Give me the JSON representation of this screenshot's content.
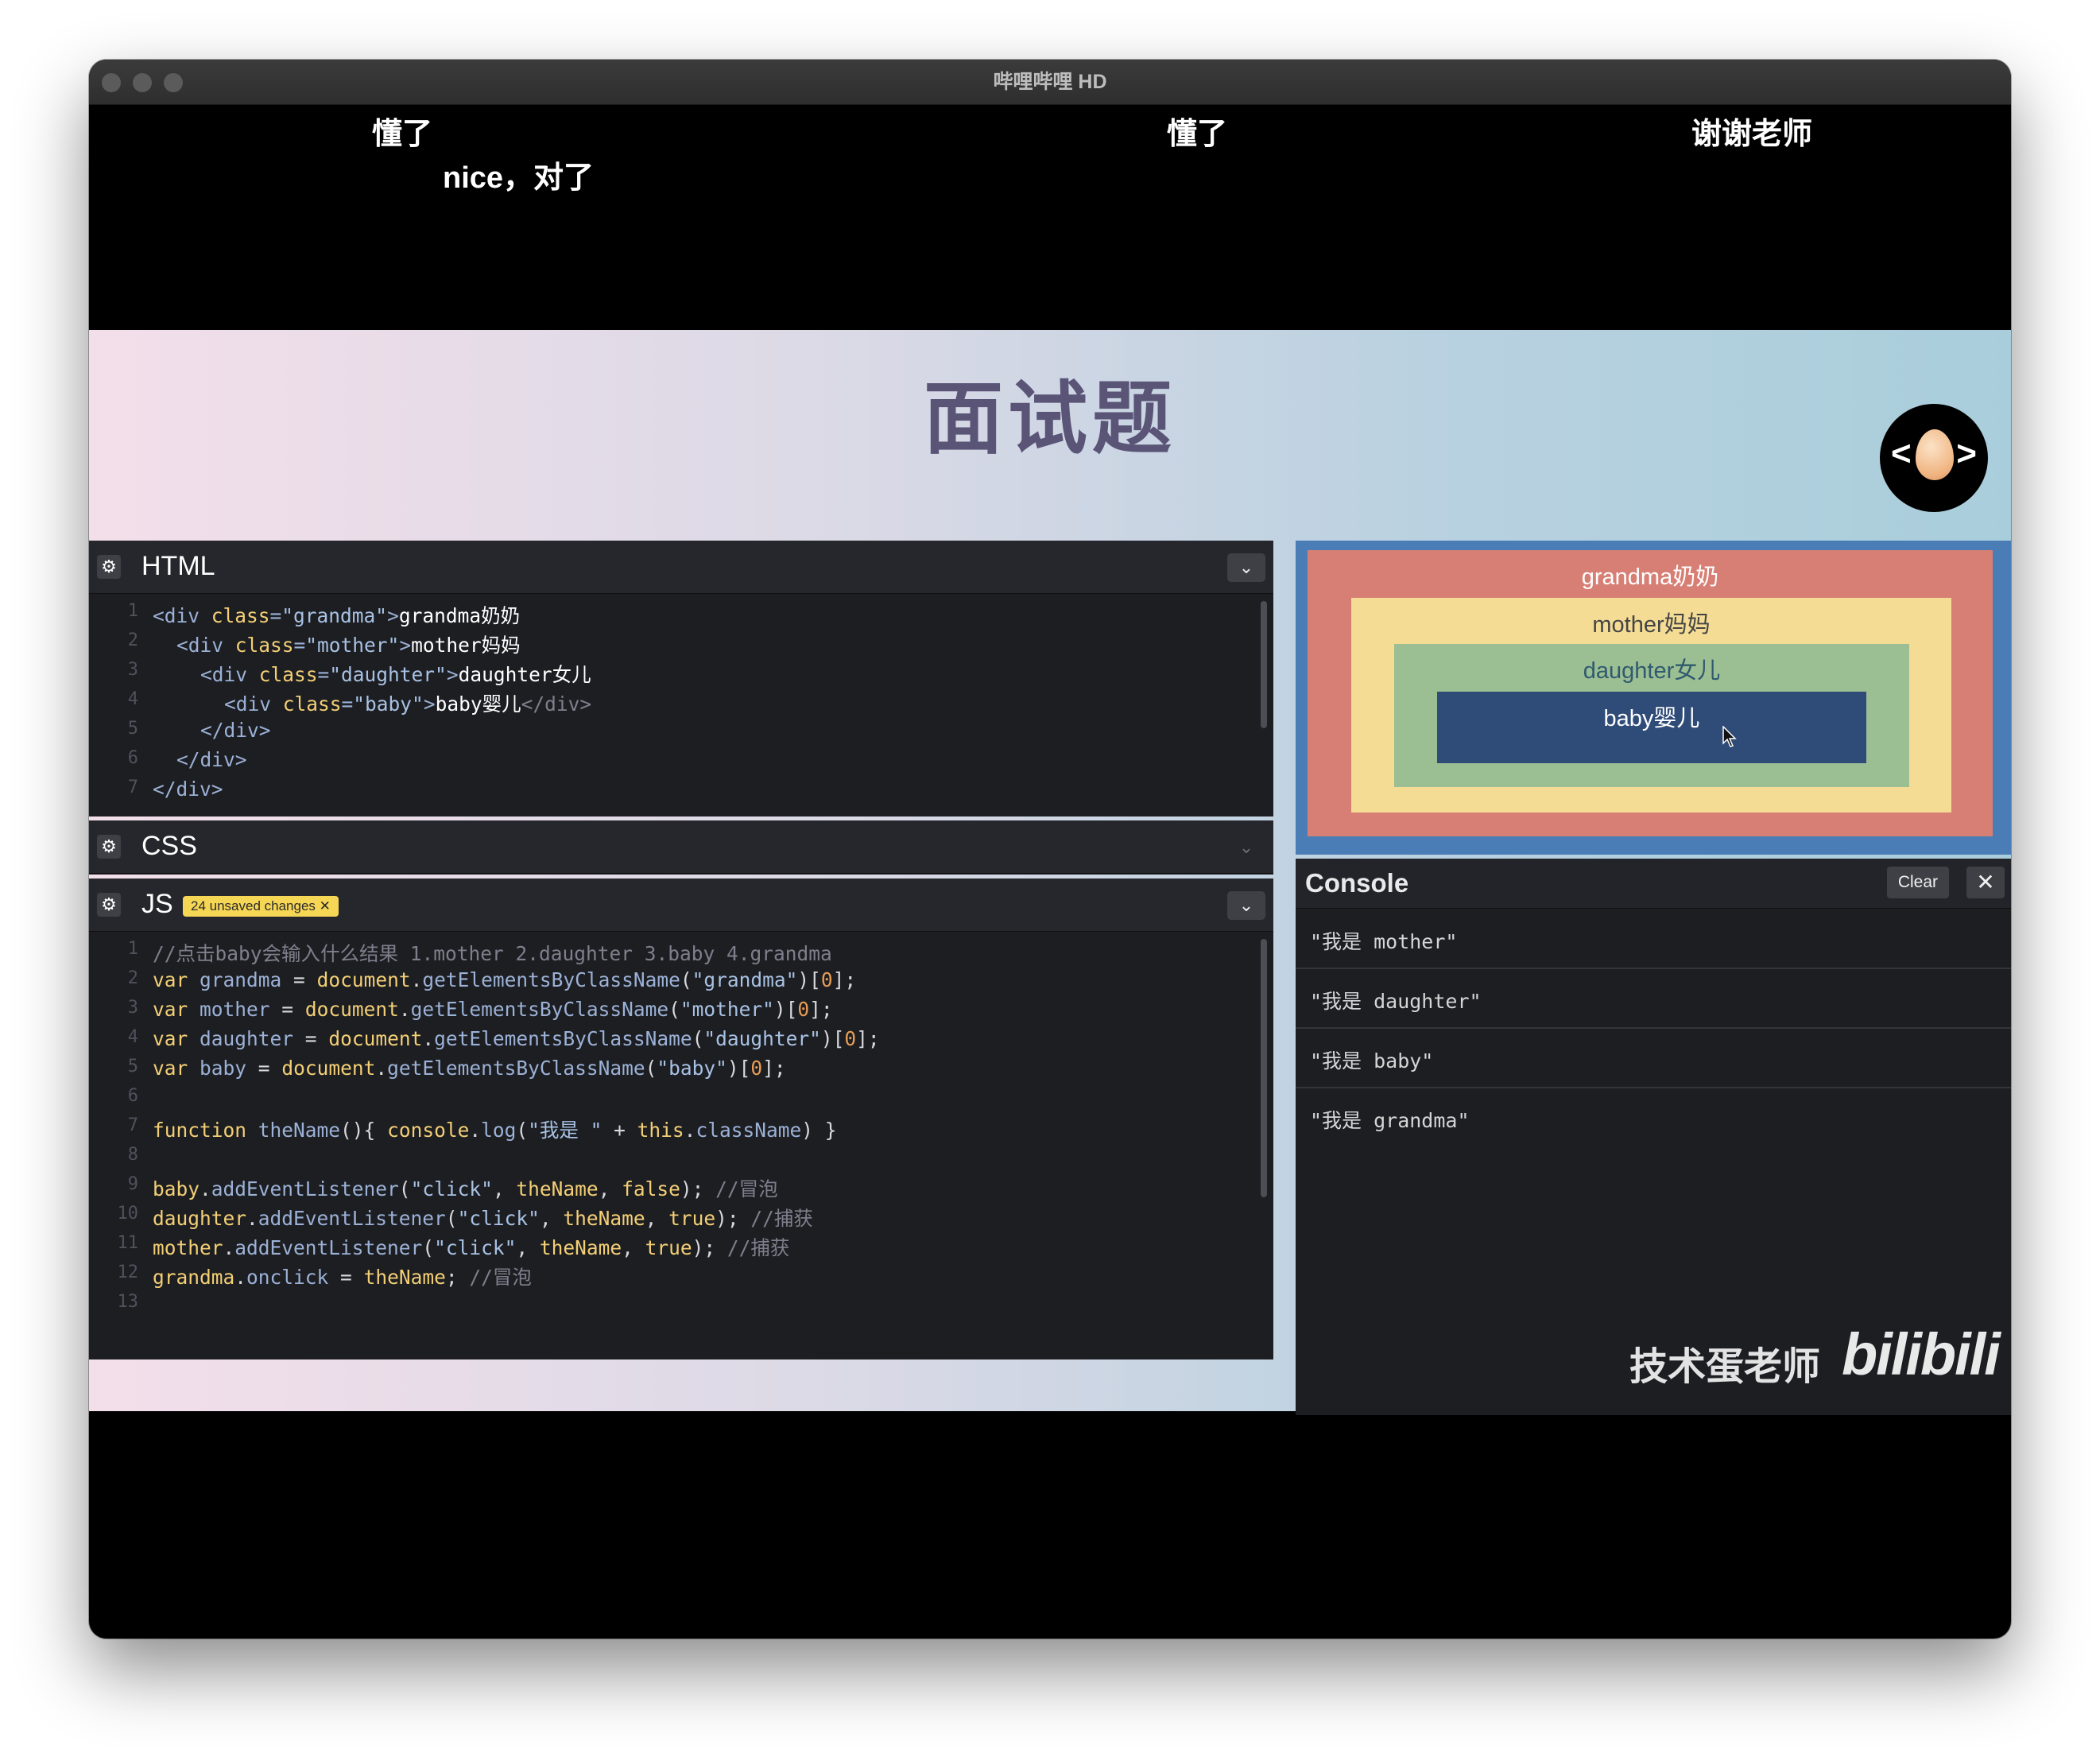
{
  "window": {
    "title": "哔哩哔哩 HD"
  },
  "danmaku": [
    "懂了",
    "nice，对了",
    "懂了",
    "谢谢老师"
  ],
  "slide": {
    "title": "面试题",
    "logo_left": "<",
    "logo_right": ">"
  },
  "html_pane": {
    "title": "HTML",
    "lines": [
      "1",
      "2",
      "3",
      "4",
      "5",
      "6",
      "7"
    ],
    "code": {
      "l1_open": "<div ",
      "l1_attr": "class",
      "l1_eq": "=",
      "l1_val": "\"grandma\"",
      "l1_gt": ">",
      "l1_text": "grandma奶奶",
      "l2_open": "<div ",
      "l2_attr": "class",
      "l2_eq": "=",
      "l2_val": "\"mother\"",
      "l2_gt": ">",
      "l2_text": "mother妈妈",
      "l3_open": "<div ",
      "l3_attr": "class",
      "l3_eq": "=",
      "l3_val": "\"daughter\"",
      "l3_gt": ">",
      "l3_text": "daughter女儿",
      "l4_open": "<div ",
      "l4_attr": "class",
      "l4_eq": "=",
      "l4_val": "\"baby\"",
      "l4_gt": ">",
      "l4_text": "baby婴儿",
      "l4_close": "</div>",
      "l5": "</div>",
      "l6": "</div>",
      "l7": "</div>"
    }
  },
  "css_pane": {
    "title": "CSS"
  },
  "js_pane": {
    "title": "JS",
    "badge": "24 unsaved changes ✕",
    "lines": [
      "1",
      "2",
      "3",
      "4",
      "5",
      "6",
      "7",
      "8",
      "9",
      "10",
      "11",
      "12",
      "13"
    ],
    "code": {
      "l1": "//点击baby会输入什么结果 1.mother 2.daughter 3.baby 4.grandma",
      "var": "var",
      "grandma": "grandma",
      "mother": "mother",
      "daughter": "daughter",
      "baby": "baby",
      "eq": " = ",
      "document": "document",
      "dot": ".",
      "gebcn": "getElementsByClassName",
      "lp": "(",
      "s_grandma": "\"grandma\"",
      "s_mother": "\"mother\"",
      "s_daughter": "\"daughter\"",
      "s_baby": "\"baby\"",
      "rp_idx_open": ")[",
      "zero": "0",
      "idx_close": "];",
      "function": "function",
      "theName": "theName",
      "fn_sig": "(){ ",
      "console": "console",
      "log": "log",
      "s_woshi": "\"我是 \"",
      "plus": " + ",
      "this": "this",
      "className": "className",
      "fn_end": ") }",
      "ael": "addEventListener",
      "s_click": "\"click\"",
      "comma": ", ",
      "false": "false",
      "true": "true",
      "close_semi": "); ",
      "cm_bubble": "//冒泡",
      "cm_capture": "//捕获",
      "onclick": "onclick",
      "semi": "; "
    }
  },
  "preview": {
    "grandma": "grandma奶奶",
    "mother": "mother妈妈",
    "daughter": "daughter女儿",
    "baby": "baby婴儿",
    "colors": {
      "frame": "#4a7db5",
      "grandma": "#d77f74",
      "mother": "#f4dc95",
      "daughter": "#9cbe93",
      "baby": "#2f4b78"
    }
  },
  "console": {
    "title": "Console",
    "clear": "Clear",
    "close": "✕",
    "logs": [
      "\"我是 mother\"",
      "\"我是 daughter\"",
      "\"我是 baby\"",
      "\"我是 grandma\""
    ]
  },
  "watermark": {
    "text": "技术蛋老师",
    "logo": "bilibili"
  }
}
